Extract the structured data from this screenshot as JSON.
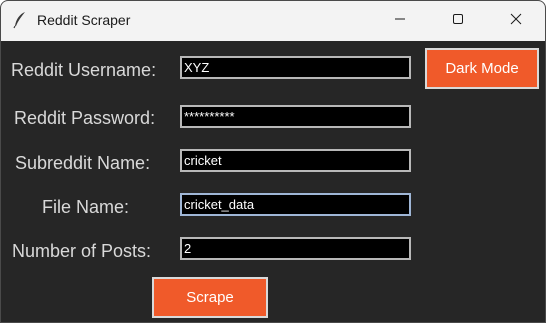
{
  "window": {
    "title": "Reddit Scraper"
  },
  "titlebar": {
    "app_icon": "feather-icon",
    "minimize_icon": "minimize-icon",
    "maximize_icon": "maximize-icon",
    "close_icon": "close-icon"
  },
  "form": {
    "username": {
      "label": "Reddit Username:",
      "value": "XYZ"
    },
    "password": {
      "label": "Reddit Password:",
      "value": "**********"
    },
    "subreddit": {
      "label": "Subreddit Name:",
      "value": "cricket"
    },
    "filename": {
      "label": "File Name:",
      "value": "cricket_data"
    },
    "num_posts": {
      "label": "Number of Posts:",
      "value": "2"
    }
  },
  "buttons": {
    "dark_mode": "Dark Mode",
    "scrape": "Scrape"
  },
  "colors": {
    "background": "#262626",
    "accent": "#f05a2a",
    "entry_bg": "#000000",
    "text": "#d9d9d9"
  }
}
